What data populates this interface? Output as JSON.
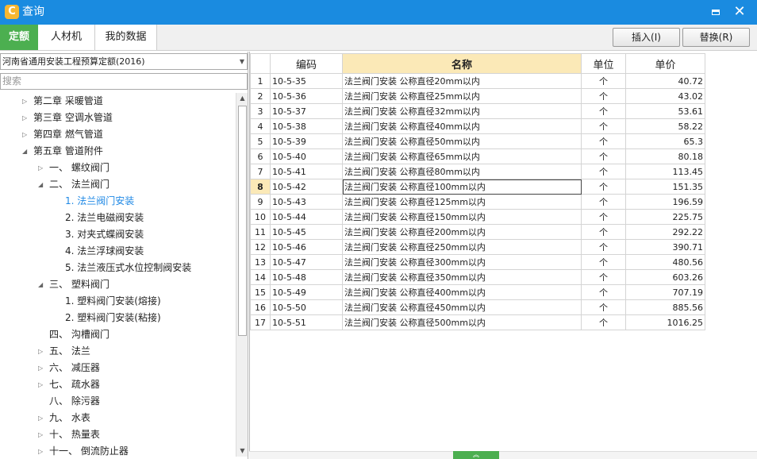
{
  "window": {
    "title": "查询",
    "app_icon": "C",
    "close_glyph": "✕"
  },
  "tabs": [
    {
      "label": "定额"
    },
    {
      "label": "人材机"
    },
    {
      "label": "我的数据"
    }
  ],
  "actions": {
    "insert": "插入(I)",
    "replace": "替换(R)"
  },
  "left": {
    "combo": "河南省通用安装工程预算定额(2016)",
    "search_placeholder": "搜索",
    "tree": [
      {
        "label": "第二章 采暖管道",
        "toggle": "▷"
      },
      {
        "label": "第三章 空调水管道",
        "toggle": "▷"
      },
      {
        "label": "第四章 燃气管道",
        "toggle": "▷"
      },
      {
        "label": "第五章 管道附件",
        "toggle": "◢"
      },
      {
        "label": "一、 螺纹阀门",
        "toggle": "▷"
      },
      {
        "label": "二、 法兰阀门",
        "toggle": "◢"
      },
      {
        "label": "1. 法兰阀门安装",
        "toggle": ""
      },
      {
        "label": "2. 法兰电磁阀安装",
        "toggle": ""
      },
      {
        "label": "3. 对夹式蝶阀安装",
        "toggle": ""
      },
      {
        "label": "4. 法兰浮球阀安装",
        "toggle": ""
      },
      {
        "label": "5. 法兰液压式水位控制阀安装",
        "toggle": ""
      },
      {
        "label": "三、 塑料阀门",
        "toggle": "◢"
      },
      {
        "label": "1. 塑料阀门安装(熔接)",
        "toggle": ""
      },
      {
        "label": "2. 塑料阀门安装(粘接)",
        "toggle": ""
      },
      {
        "label": "四、 沟槽阀门",
        "toggle": ""
      },
      {
        "label": "五、 法兰",
        "toggle": "▷"
      },
      {
        "label": "六、 减压器",
        "toggle": "▷"
      },
      {
        "label": "七、 疏水器",
        "toggle": "▷"
      },
      {
        "label": "八、 除污器",
        "toggle": ""
      },
      {
        "label": "九、 水表",
        "toggle": "▷"
      },
      {
        "label": "十、 热量表",
        "toggle": "▷"
      },
      {
        "label": "十一、 倒流防止器",
        "toggle": "▷"
      }
    ]
  },
  "grid": {
    "headers": [
      "编码",
      "名称",
      "单位",
      "单价"
    ],
    "rows": [
      {
        "no": "1",
        "code": "10-5-35",
        "name": "法兰阀门安装 公称直径20mm以内",
        "unit": "个",
        "price": "40.72"
      },
      {
        "no": "2",
        "code": "10-5-36",
        "name": "法兰阀门安装 公称直径25mm以内",
        "unit": "个",
        "price": "43.02"
      },
      {
        "no": "3",
        "code": "10-5-37",
        "name": "法兰阀门安装 公称直径32mm以内",
        "unit": "个",
        "price": "53.61"
      },
      {
        "no": "4",
        "code": "10-5-38",
        "name": "法兰阀门安装 公称直径40mm以内",
        "unit": "个",
        "price": "58.22"
      },
      {
        "no": "5",
        "code": "10-5-39",
        "name": "法兰阀门安装 公称直径50mm以内",
        "unit": "个",
        "price": "65.3"
      },
      {
        "no": "6",
        "code": "10-5-40",
        "name": "法兰阀门安装 公称直径65mm以内",
        "unit": "个",
        "price": "80.18"
      },
      {
        "no": "7",
        "code": "10-5-41",
        "name": "法兰阀门安装 公称直径80mm以内",
        "unit": "个",
        "price": "113.45"
      },
      {
        "no": "8",
        "code": "10-5-42",
        "name": "法兰阀门安装 公称直径100mm以内",
        "unit": "个",
        "price": "151.35"
      },
      {
        "no": "9",
        "code": "10-5-43",
        "name": "法兰阀门安装 公称直径125mm以内",
        "unit": "个",
        "price": "196.59"
      },
      {
        "no": "10",
        "code": "10-5-44",
        "name": "法兰阀门安装 公称直径150mm以内",
        "unit": "个",
        "price": "225.75"
      },
      {
        "no": "11",
        "code": "10-5-45",
        "name": "法兰阀门安装 公称直径200mm以内",
        "unit": "个",
        "price": "292.22"
      },
      {
        "no": "12",
        "code": "10-5-46",
        "name": "法兰阀门安装 公称直径250mm以内",
        "unit": "个",
        "price": "390.71"
      },
      {
        "no": "13",
        "code": "10-5-47",
        "name": "法兰阀门安装 公称直径300mm以内",
        "unit": "个",
        "price": "480.56"
      },
      {
        "no": "14",
        "code": "10-5-48",
        "name": "法兰阀门安装 公称直径350mm以内",
        "unit": "个",
        "price": "603.26"
      },
      {
        "no": "15",
        "code": "10-5-49",
        "name": "法兰阀门安装 公称直径400mm以内",
        "unit": "个",
        "price": "707.19"
      },
      {
        "no": "16",
        "code": "10-5-50",
        "name": "法兰阀门安装 公称直径450mm以内",
        "unit": "个",
        "price": "885.56"
      },
      {
        "no": "17",
        "code": "10-5-51",
        "name": "法兰阀门安装 公称直径500mm以内",
        "unit": "个",
        "price": "1016.25"
      }
    ]
  }
}
